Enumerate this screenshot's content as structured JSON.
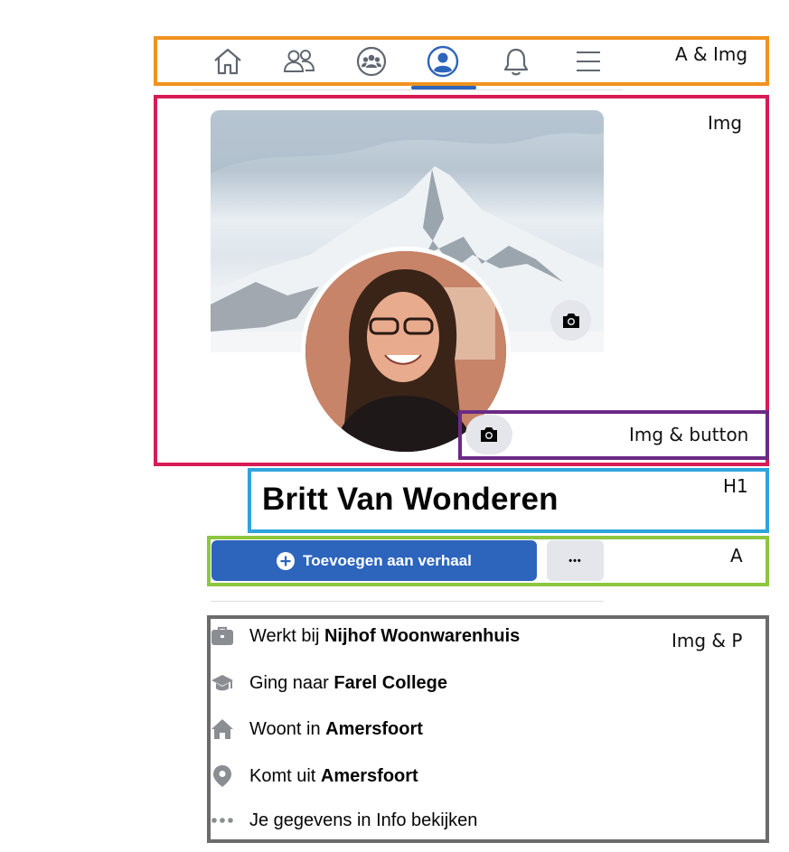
{
  "annotations": {
    "nav": "A & Img",
    "cover": "Img",
    "camera": "Img & button",
    "heading": "H1",
    "actions": "A",
    "info": "Img & P"
  },
  "nav": {
    "icons": [
      "home-icon",
      "friends-icon",
      "groups-icon",
      "profile-icon",
      "bell-icon",
      "menu-icon"
    ],
    "active": "profile-icon"
  },
  "profile": {
    "name": "Britt Van Wonderen"
  },
  "actions": {
    "story_label": "Toevoegen aan verhaal",
    "more_label": "•••"
  },
  "info": [
    {
      "icon": "briefcase-icon",
      "prefix": "Werkt bij ",
      "bold": "Nijhof Woonwarenhuis"
    },
    {
      "icon": "graduation-cap-icon",
      "prefix": "Ging naar ",
      "bold": "Farel College"
    },
    {
      "icon": "house-icon",
      "prefix": "Woont in ",
      "bold": "Amersfoort"
    },
    {
      "icon": "location-pin-icon",
      "prefix": "Komt uit ",
      "bold": "Amersfoort"
    },
    {
      "icon": "dots-icon",
      "prefix": "Je gegevens in Info bekijken",
      "bold": ""
    }
  ],
  "colors": {
    "accent": "#2d64bc",
    "nav_box": "#f0931e",
    "cover_box": "#d81b55",
    "camera_box": "#6b2a85",
    "h1_box": "#2ea4dd",
    "a_box": "#8dc63f",
    "info_box": "#6b6b6b"
  }
}
